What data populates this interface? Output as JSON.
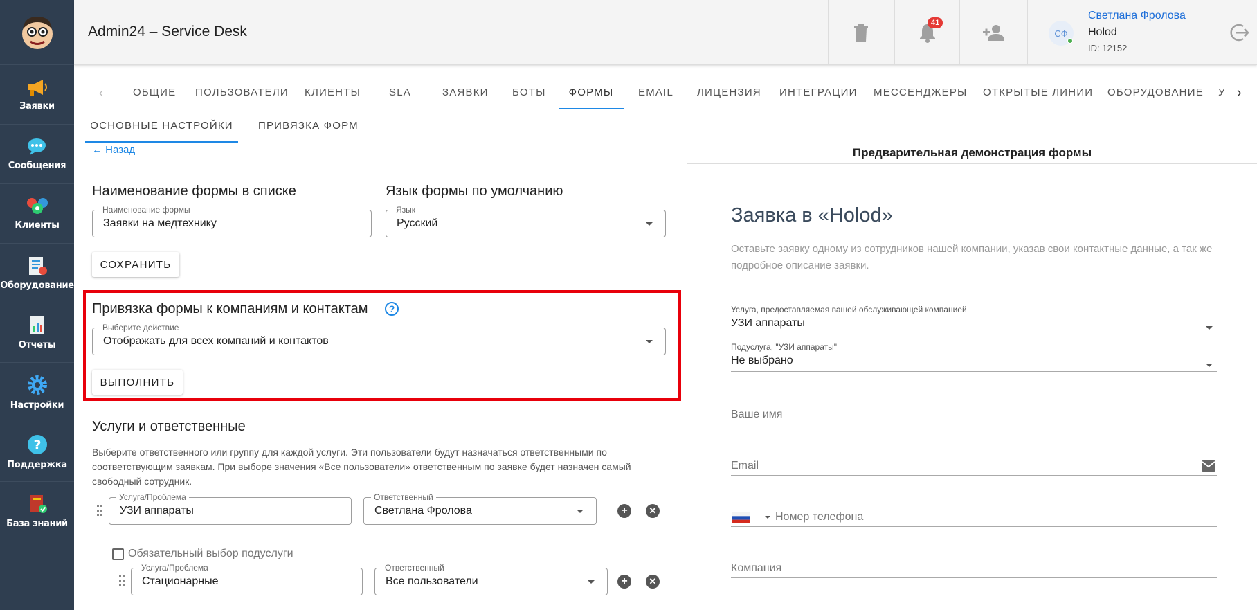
{
  "app": {
    "title": "Admin24 – Service Desk"
  },
  "sidebar": {
    "items": [
      {
        "label": "Заявки",
        "icon": "megaphone-icon"
      },
      {
        "label": "Сообщения",
        "icon": "chat-bubble-icon"
      },
      {
        "label": "Клиенты",
        "icon": "people-icon"
      },
      {
        "label": "Оборудование",
        "icon": "equipment-checklist-icon"
      },
      {
        "label": "Отчеты",
        "icon": "report-chart-icon"
      },
      {
        "label": "Настройки",
        "icon": "gear-icon"
      },
      {
        "label": "Поддержка",
        "icon": "help-question-icon"
      },
      {
        "label": "База знаний",
        "icon": "knowledge-book-icon"
      }
    ]
  },
  "header": {
    "notifications_count": "41",
    "user": {
      "initials": "СФ",
      "name": "Светлана Фролова",
      "company": "Holod",
      "id": "ID: 12152"
    }
  },
  "tabs": {
    "items": [
      "Общие",
      "Пользователи",
      "Клиенты",
      "SLA",
      "Заявки",
      "Боты",
      "Формы",
      "Email",
      "Лицензия",
      "Интеграции",
      "Мессенджеры",
      "Открытые линии",
      "Оборудование",
      "У"
    ],
    "active": "Формы"
  },
  "subtabs": {
    "items": [
      "ОСНОВНЫЕ НАСТРОЙКИ",
      "ПРИВЯЗКА ФОРМ"
    ]
  },
  "back_label": "Назад",
  "form_name": {
    "title": "Наименование формы в списке",
    "field_label": "Наименование формы",
    "value": "Заявки на медтехнику"
  },
  "form_lang": {
    "title": "Язык формы по умолчанию",
    "field_label": "Язык",
    "value": "Русский"
  },
  "save_label": "СОХРАНИТЬ",
  "binding": {
    "title": "Привязка формы к компаниям и контактам",
    "field_label": "Выберите действие",
    "value": "Отображать для всех компаний и контактов",
    "execute_label": "ВЫПОЛНИТЬ"
  },
  "services": {
    "title": "Услуги и ответственные",
    "description": "Выберите ответственного или группу для каждой услуги. Эти пользователи будут назначаться ответственными по соответствующим заявкам. При выборе значения «Все пользователи» ответственным по заявке будет назначен самый свободный сотрудник.",
    "service_label": "Услуга/Проблема",
    "responsible_label": "Ответственный",
    "row1": {
      "service": "УЗИ аппараты",
      "responsible": "Светлана Фролова"
    },
    "required_sub_label": "Обязательный выбор подуслуги",
    "row2": {
      "service": "Стационарные",
      "responsible": "Все пользователи"
    }
  },
  "preview": {
    "header": "Предварительная демонстрация формы",
    "title": "Заявка в «Holod»",
    "description": "Оставьте заявку одному из сотрудников нашей компании, указав свои контактные данные, а так же подробное описание заявки.",
    "service_label": "Услуга, предоставляемая вашей обслуживающей компанией",
    "service_value": "УЗИ аппараты",
    "subservice_label": "Подуслуга, \"УЗИ аппараты\"",
    "subservice_value": "Не выбрано",
    "name_placeholder": "Ваше имя",
    "email_placeholder": "Email",
    "phone_placeholder": "Номер телефона",
    "company_placeholder": "Компания"
  }
}
